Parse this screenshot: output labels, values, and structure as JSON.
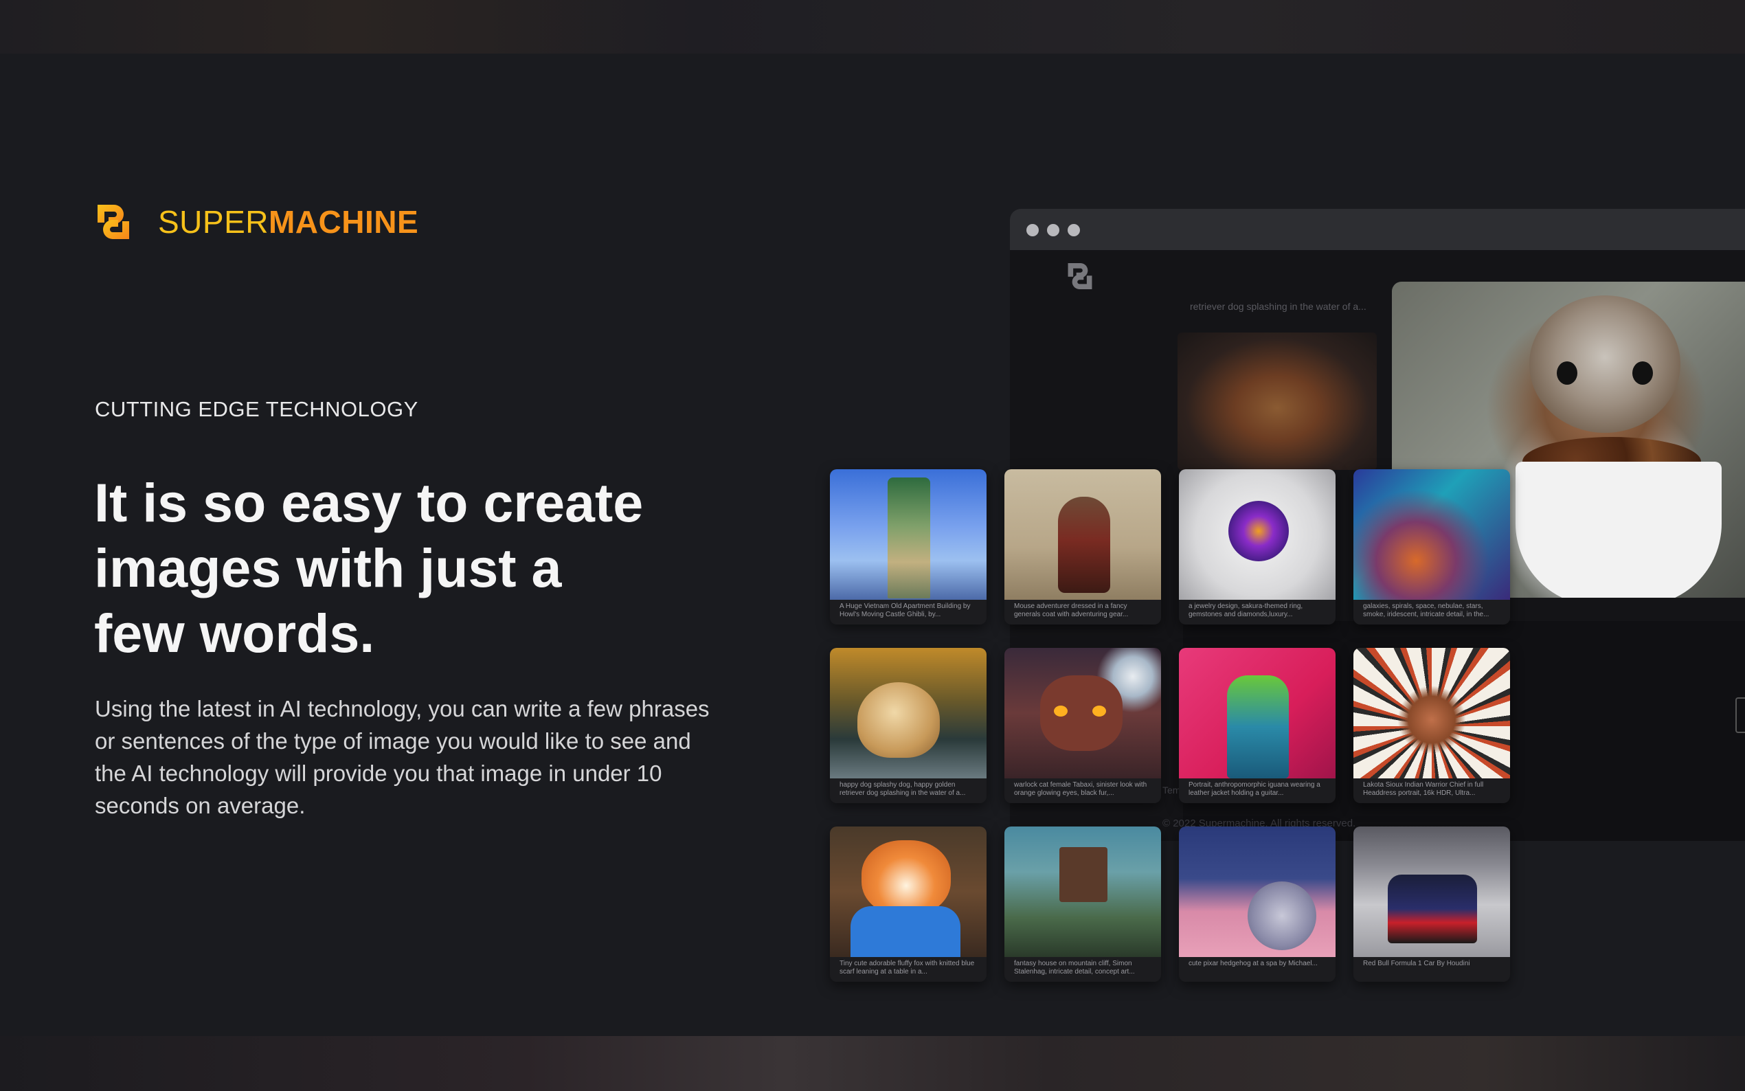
{
  "brand": {
    "part1": "SUPER",
    "part2": "MACHINE",
    "accent": "#f7931a",
    "accent2": "#f6c11a"
  },
  "hero": {
    "eyebrow": "CUTTING EDGE TECHNOLOGY",
    "headline_l1": "It is so easy to create",
    "headline_l2": "images with just a",
    "headline_l3": "few words.",
    "body": "Using the latest in AI technology, you can write a few phrases or sentences of the type of image you would like to see and the AI technology will provide you that image in under 10 seconds on average."
  },
  "mock": {
    "bg_caption": "retriever dog splashing in the water of a...",
    "bg_term": "Tem",
    "copyright": "© 2022 Supermachine. All rights reserved."
  },
  "cards": [
    {
      "caption": "A Huge Vietnam Old Apartment Building by Howl's Moving Castle Ghibli, by...",
      "icon": "green-tower-art"
    },
    {
      "caption": "Mouse adventurer dressed in a fancy generals coat with adventuring gear...",
      "icon": "mouse-general-art"
    },
    {
      "caption": "a jewelry design, sakura-themed ring, gemstones and diamonds,luxury...",
      "icon": "ring-art"
    },
    {
      "caption": "galaxies, spirals, space, nebulae, stars, smoke, iridescent, intricate detail, in the...",
      "icon": "space-rabbit-art"
    },
    {
      "caption": "happy dog splashy dog, happy golden retriever dog splashing in the water of a...",
      "icon": "golden-retriever-art"
    },
    {
      "caption": "warlock cat female Tabaxi, sinister look with orange glowing eyes, black fur,...",
      "icon": "warlock-cat-art"
    },
    {
      "caption": "Portrait, anthropomorphic iguana wearing a leather jacket holding a guitar...",
      "icon": "iguana-guitar-art"
    },
    {
      "caption": "Lakota Sioux Indian Warrior Chief in full Headdress portrait, 16k HDR, Ultra...",
      "icon": "chief-headdress-art"
    },
    {
      "caption": "Tiny cute adorable fluffy fox with knitted blue scarf leaning at a table in a...",
      "icon": "fox-scarf-art"
    },
    {
      "caption": "fantasy house on mountain cliff, Simon Stalenhag, intricate detail, concept art...",
      "icon": "fantasy-house-art"
    },
    {
      "caption": "cute pixar hedgehog at a spa by Michael...",
      "icon": "hedgehog-art"
    },
    {
      "caption": "Red Bull Formula 1 Car By Houdini",
      "icon": "f1-car-art"
    }
  ]
}
